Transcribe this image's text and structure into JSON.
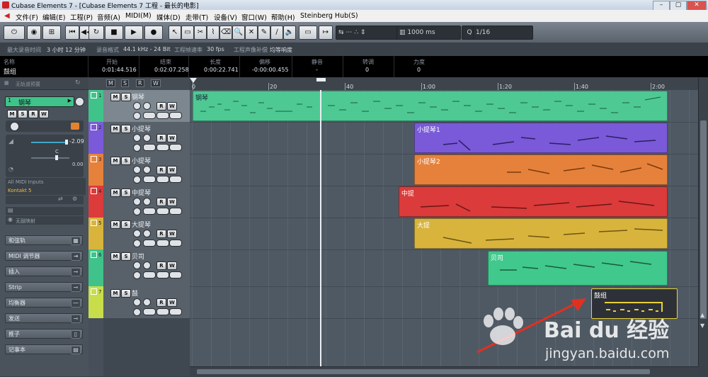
{
  "window": {
    "title": "Cubase Elements 7 - [Cubase Elements 7 工程 - 最长的电影]",
    "minimize": "–",
    "maximize": "▢",
    "close": "✕"
  },
  "menu": [
    "文件(F)",
    "编辑(E)",
    "工程(P)",
    "音频(A)",
    "MIDI(M)",
    "媒体(D)",
    "走带(T)",
    "设备(V)",
    "窗口(W)",
    "帮助(H)",
    "Steinberg Hub(S)"
  ],
  "toolbar": {
    "time_value": "1000 ms",
    "quantize": "1/16",
    "quantize_label": "Q"
  },
  "info_line": {
    "rec_time_label": "最大录音时间",
    "rec_time": "3 小时 12 分钟",
    "rec_format_label": "录音格式",
    "rec_format": "44.1 kHz - 24 Bit",
    "frame_rate_label": "工程帧速率",
    "frame_rate": "30 fps",
    "pan_label": "工程声像补偿",
    "pan": "均等响度"
  },
  "event_info": {
    "headers": [
      "名称",
      "开始",
      "结束",
      "长度",
      "偏移",
      "静音",
      "转调",
      "力度"
    ],
    "values": [
      "鼓组",
      "0:01:44.516",
      "0:02:07.258",
      "0:00:22.741",
      "-0:00:00.455",
      "-",
      "0",
      "0"
    ]
  },
  "inspector": {
    "search_placeholder": "无轨道预置",
    "track_name": "钢琴",
    "volume": "-2.09",
    "pan_center": "C",
    "pan_value": "0.00",
    "input": "All MIDI Inputs",
    "output": "Kontakt 5",
    "no_drum_map": "无鼓映射",
    "sections": [
      "和弦轨",
      "MIDI 调节器",
      "插入",
      "Strip",
      "均衡器",
      "发送",
      "推子",
      "记事本"
    ]
  },
  "tracks": [
    {
      "num": "1",
      "name": "钢琴",
      "color": "#3fc38a"
    },
    {
      "num": "2",
      "name": "小提琴",
      "color": "#7a5ad8"
    },
    {
      "num": "3",
      "name": "小提琴",
      "color": "#e6813b"
    },
    {
      "num": "4",
      "name": "中提琴",
      "color": "#db3b3b"
    },
    {
      "num": "5",
      "name": "大提琴",
      "color": "#d8b43d"
    },
    {
      "num": "6",
      "name": "贝司",
      "color": "#3fc38a"
    },
    {
      "num": "7",
      "name": "鼓",
      "color": "#c8dd4a"
    }
  ],
  "ruler": {
    "bars": [
      "0",
      "20",
      "40"
    ],
    "times": [
      "1:00",
      "1:20",
      "1:40",
      "2:00"
    ]
  },
  "parts": [
    {
      "label": "钢琴",
      "color": "#4ec993"
    },
    {
      "label": "小提琴1",
      "color": "#7a5ad8"
    },
    {
      "label": "小提琴2",
      "color": "#e6813b"
    },
    {
      "label": "中提",
      "color": "#db3b3b"
    },
    {
      "label": "大提",
      "color": "#d8b43d"
    },
    {
      "label": "贝司",
      "color": "#41c88c"
    },
    {
      "label": "鼓组",
      "color": "#2d3137"
    }
  ],
  "watermark": {
    "brand": "Bai du 经验",
    "url": "jingyan.baidu.com"
  }
}
